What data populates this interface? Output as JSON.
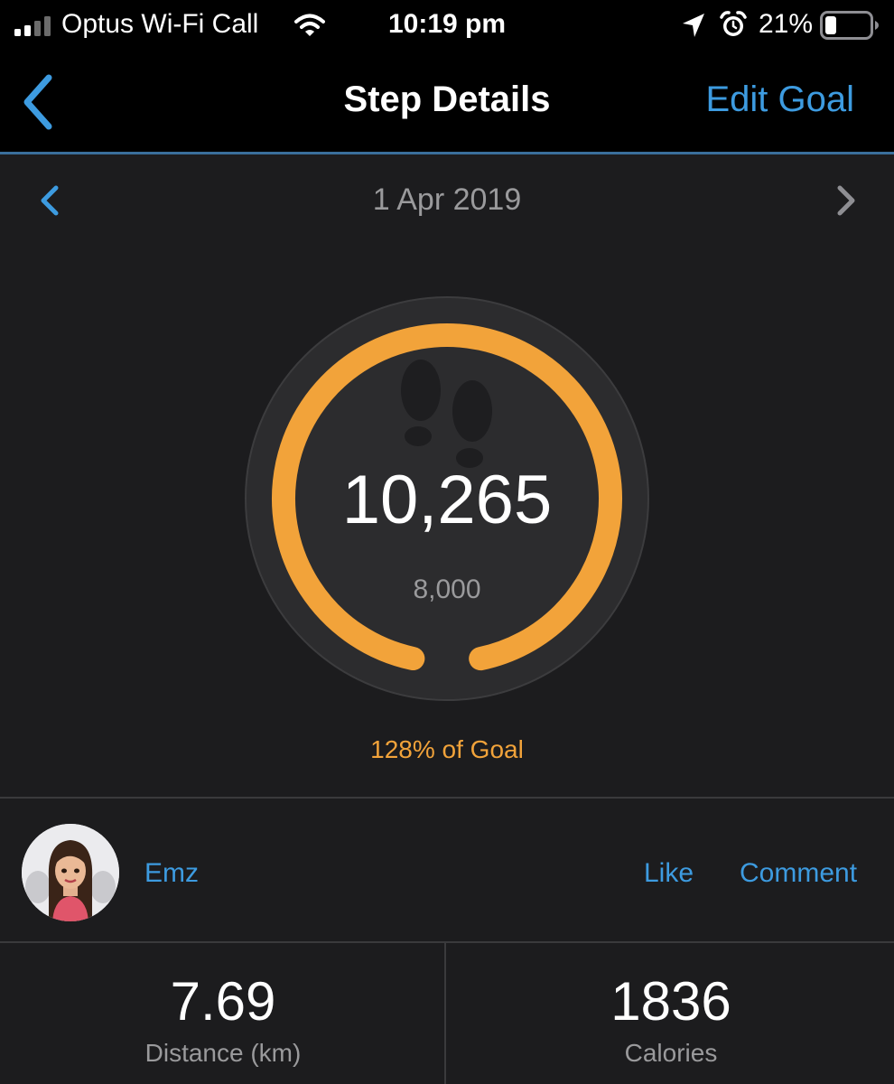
{
  "status_bar": {
    "carrier": "Optus Wi-Fi Call",
    "time": "10:19 pm",
    "battery_percent": "21%",
    "icons": [
      "signal-icon",
      "wifi-icon",
      "location-arrow-icon",
      "alarm-icon",
      "battery-icon"
    ]
  },
  "nav": {
    "title": "Step Details",
    "edit_label": "Edit Goal"
  },
  "date": {
    "label": "1 Apr 2019"
  },
  "steps": {
    "count": "10,265",
    "goal": "8,000",
    "percent_text": "128% of Goal"
  },
  "social": {
    "user_name": "Emz",
    "like_label": "Like",
    "comment_label": "Comment"
  },
  "stats": {
    "distance_value": "7.69",
    "distance_label": "Distance (km)",
    "calories_value": "1836",
    "calories_label": "Calories"
  },
  "colors": {
    "accent_blue": "#3d9be0",
    "gauge_orange": "#f2a33a",
    "background": "#1c1c1e",
    "header": "#000000"
  }
}
